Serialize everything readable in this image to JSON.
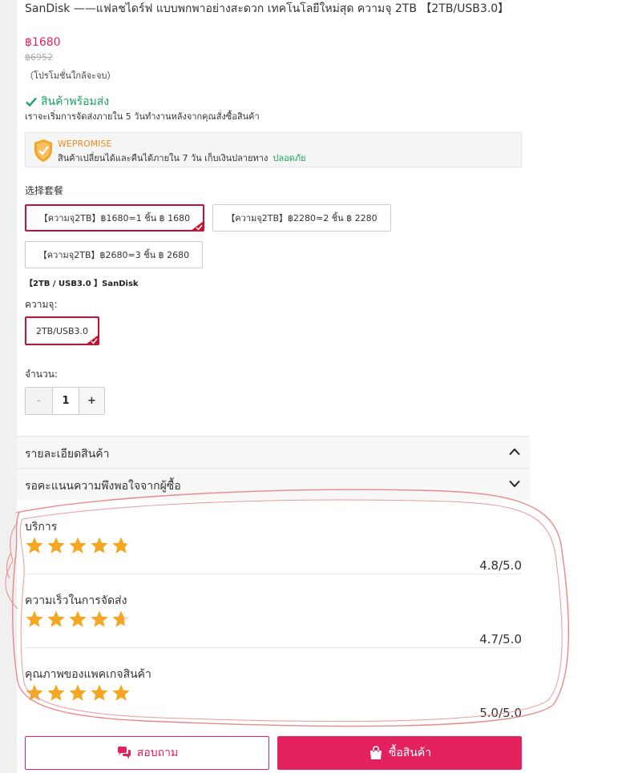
{
  "product": {
    "title": "SanDisk ——แฟลชไดร์ฟ แบบพกพาอย่างสะดวก เทคโนโลยีใหม่สุด ความจุ 2TB 【2TB/USB3.0】",
    "price": "฿1680",
    "old_price": "฿6952",
    "promo_note": "（โปรโมชั่นใกล้จะจบ）",
    "stock_status": "สินค้าพร้อมส่ง",
    "ship_note": "เราจะเริ่มการจัดส่งภายใน 5 วันทำงานหลังจากคุณสั่งซื้อสินค้า"
  },
  "promise": {
    "title": "WEPROMISE",
    "text": "สินค้าเปลี่ยนได้และคืนได้ภายใน 7 วัน  เก็บเงินปลายทาง",
    "safe": "ปลอดภัย"
  },
  "package": {
    "label": "选择套餐",
    "options": [
      {
        "label": "【ความจุ2TB】฿1680=1 ชิ้น ฿ 1680",
        "selected": true
      },
      {
        "label": "【ความจุ2TB】฿2280=2 ชิ้น ฿ 2280",
        "selected": false
      },
      {
        "label": "【ความจุ2TB】฿2680=3 ชิ้น ฿ 2680",
        "selected": false
      }
    ]
  },
  "variant": {
    "brand_line": "【2TB / USB3.0 】SanDisk",
    "capacity_label": "ความจุ:",
    "capacity_value": "2TB/USB3.0"
  },
  "quantity": {
    "label": "จำนวน:",
    "minus": "-",
    "value": "1",
    "plus": "+"
  },
  "sections": {
    "details": "รายละเอียดสินค้า",
    "satisfaction": "รอคะแนนความพึงพอใจจากผู้ซื้อ"
  },
  "ratings": [
    {
      "label": "บริการ",
      "score": "4.8/5.0",
      "value": 4.8
    },
    {
      "label": "ความเร็วในการจัดส่ง",
      "score": "4.7/5.0",
      "value": 4.7
    },
    {
      "label": "คุณภาพของแพคเกจสินค้า",
      "score": "5.0/5.0",
      "value": 5.0
    }
  ],
  "actions": {
    "ask": "สอบถาม",
    "buy": "ซื้อสินค้า"
  },
  "colors": {
    "accent": "#e4215f",
    "green": "#1aa260",
    "star": "#f5a623"
  }
}
